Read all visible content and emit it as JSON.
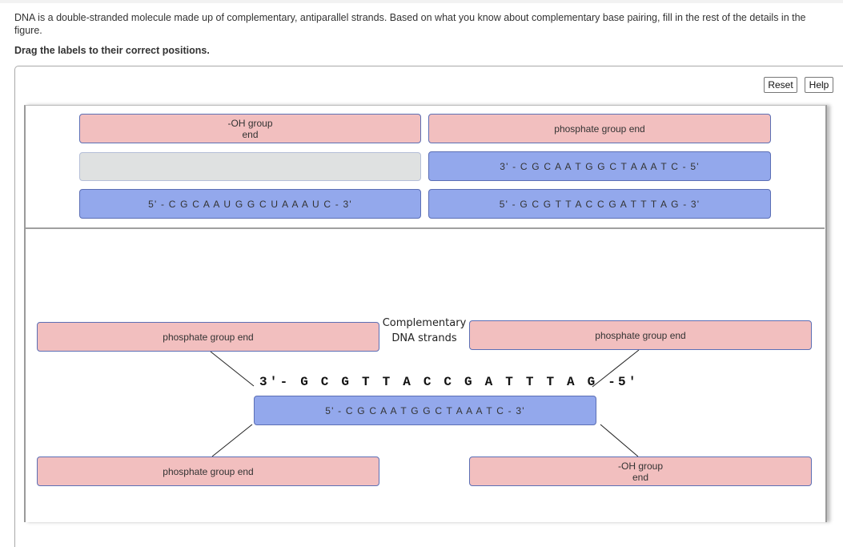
{
  "intro_text": "DNA is a double-stranded molecule made up of complementary, antiparallel strands. Based on what you know about complementary base pairing, fill in the rest of the details in the figure.",
  "instruction": "Drag the labels to their correct positions.",
  "toolbar": {
    "reset_label": "Reset",
    "help_label": "Help"
  },
  "label_bank": {
    "items": [
      {
        "text": "-OH group\nend",
        "line1": "-OH group",
        "line2": "end",
        "type": "pink"
      },
      {
        "text": "phosphate group end",
        "type": "pink"
      },
      {
        "text": "",
        "type": "empty"
      },
      {
        "text": "3' - C G C A A T G G C T A A A T C - 5'",
        "type": "blue"
      },
      {
        "text": "5' - C G C A A U G G C U A A A U C - 3'",
        "type": "blue"
      },
      {
        "text": "5' - G C G T T A C C G A T T T A G - 3'",
        "type": "blue"
      }
    ]
  },
  "diagram": {
    "caption_line1": "Complementary",
    "caption_line2": "DNA strands",
    "given_strand": "3'- G C G T T A C C G A T T T A G -5'",
    "targets": {
      "top_left": "phosphate group end",
      "top_right": "phosphate group end",
      "middle_strand": "5' - C G C A A T G G C T A A A T C - 3'",
      "bottom_left": "phosphate group end",
      "bottom_right_line1": "-OH group",
      "bottom_right_line2": "end"
    }
  },
  "colors": {
    "pink_label": "#f2bfbf",
    "blue_label": "#93a8ec",
    "empty_label": "#dfe1e1",
    "label_border": "#5c6fb5"
  }
}
